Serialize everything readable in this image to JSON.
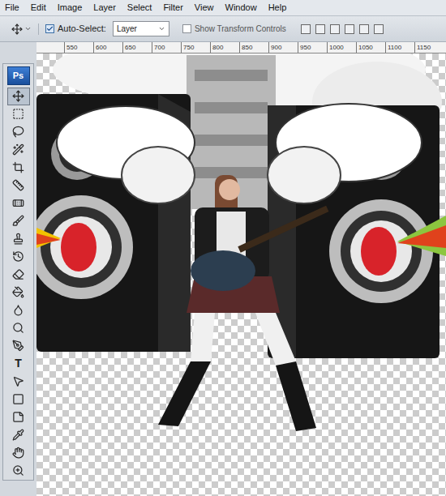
{
  "menu": [
    "File",
    "Edit",
    "Image",
    "Layer",
    "Select",
    "Filter",
    "View",
    "Window",
    "Help"
  ],
  "options_bar": {
    "auto_select": {
      "label": "Auto-Select:",
      "checked": true
    },
    "auto_select_target": "Layer",
    "show_transform_controls": {
      "label": "Show Transform Controls",
      "checked": false
    }
  },
  "ruler": {
    "ticks": [
      "550",
      "600",
      "650",
      "700",
      "750",
      "800",
      "850",
      "900",
      "950",
      "1000",
      "1050",
      "1100",
      "1150"
    ]
  },
  "toolbar": {
    "logo": "Ps",
    "tools": [
      {
        "selected": true
      },
      {
        "selected": false
      },
      {
        "selected": false
      },
      {
        "selected": false
      },
      {
        "selected": false
      },
      {
        "selected": false
      },
      {
        "selected": false
      },
      {
        "selected": false
      },
      {
        "selected": false
      },
      {
        "selected": false
      },
      {
        "selected": false
      },
      {
        "selected": false
      },
      {
        "selected": false
      },
      {
        "selected": false
      },
      {
        "selected": false
      },
      {
        "label": "T",
        "selected": false
      },
      {
        "selected": false
      },
      {
        "selected": false
      },
      {
        "selected": false
      },
      {
        "selected": false
      },
      {
        "selected": false
      },
      {
        "selected": false
      }
    ]
  }
}
